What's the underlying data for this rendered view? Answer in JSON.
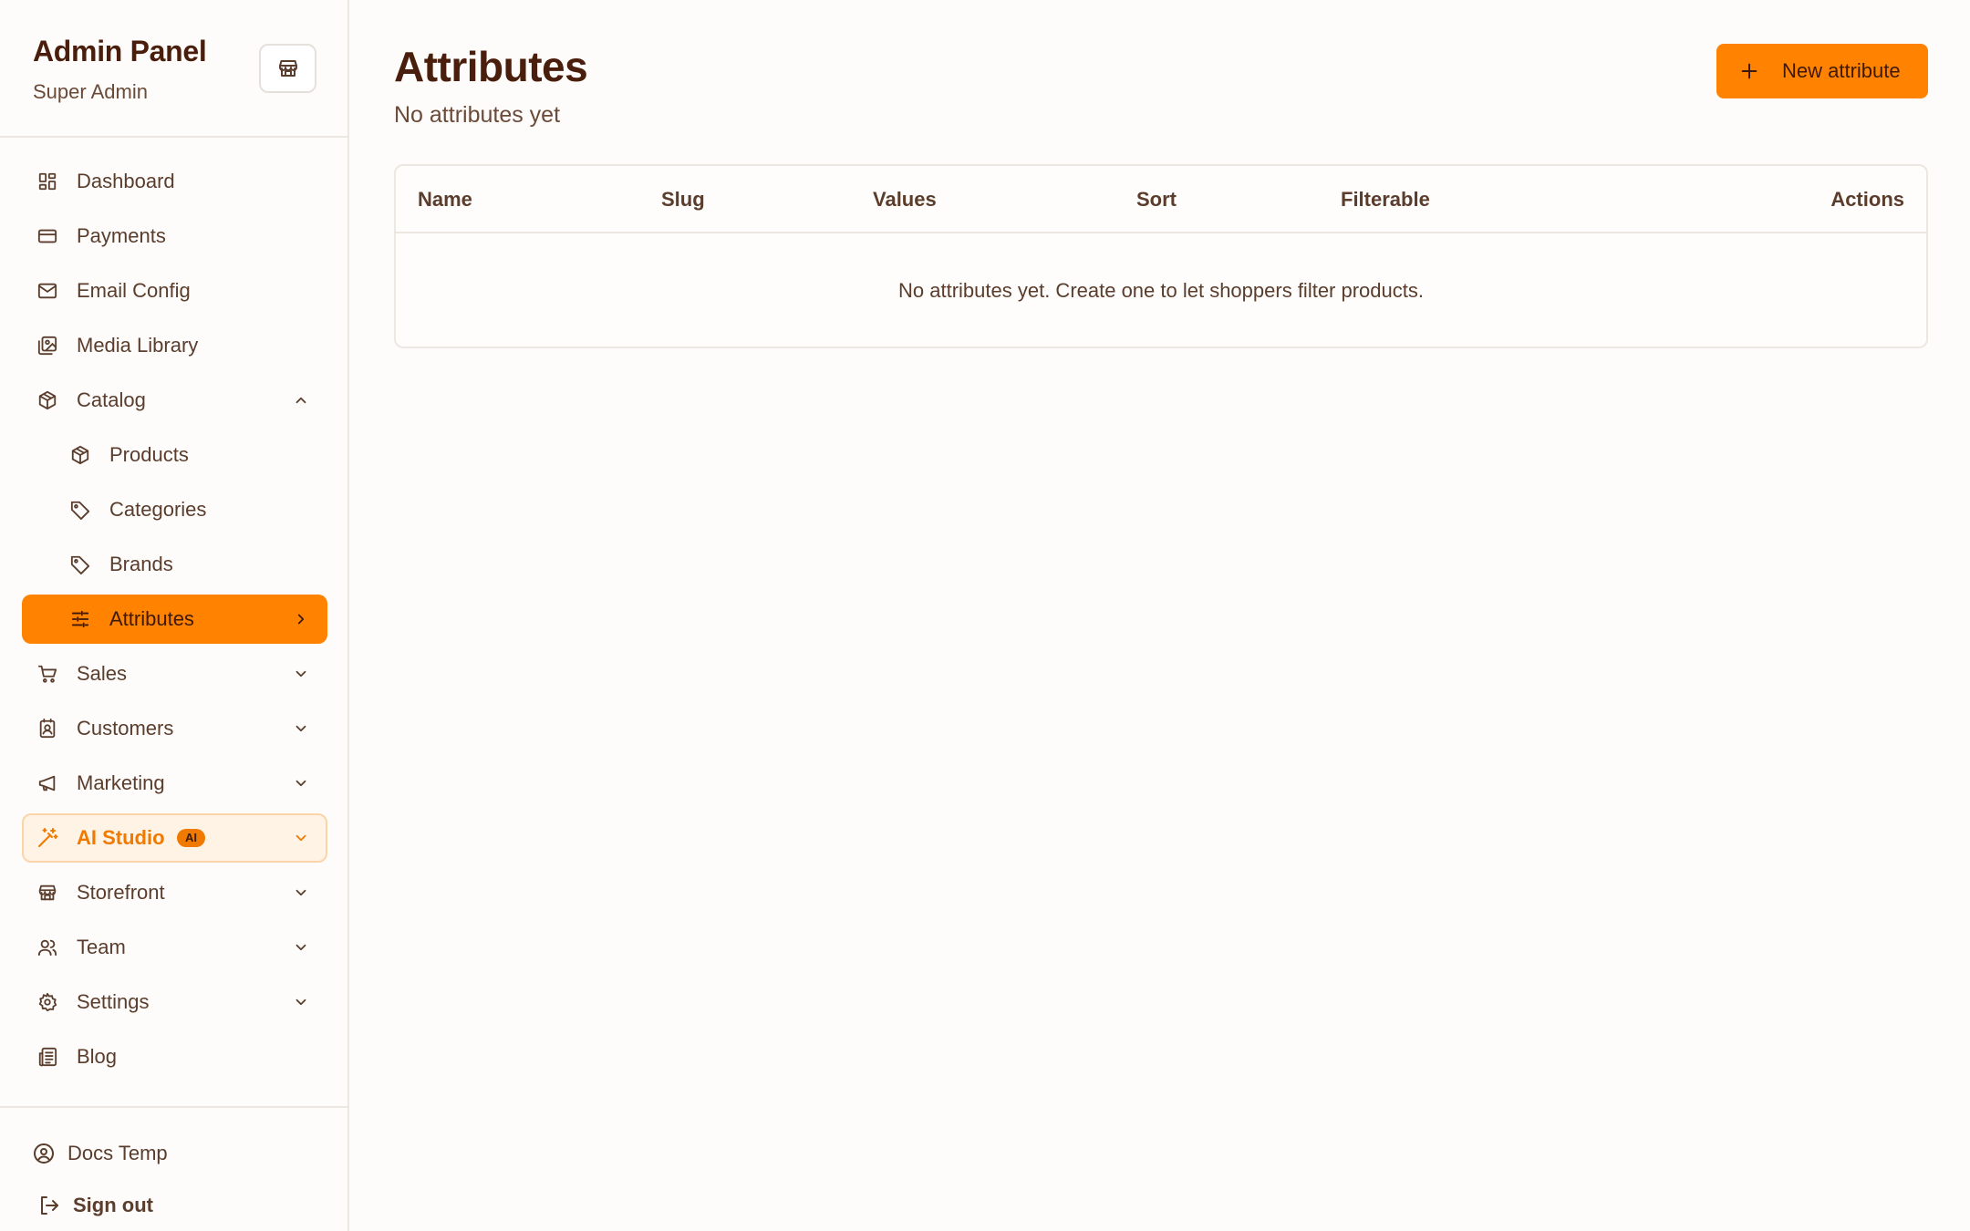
{
  "sidebar": {
    "title": "Admin Panel",
    "role": "Super Admin",
    "items": [
      {
        "label": "Dashboard",
        "icon": "dashboard-icon"
      },
      {
        "label": "Payments",
        "icon": "credit-card-icon"
      },
      {
        "label": "Email Config",
        "icon": "mail-icon"
      },
      {
        "label": "Media Library",
        "icon": "image-library-icon"
      },
      {
        "label": "Catalog",
        "icon": "package-icon",
        "expanded": true
      },
      {
        "label": "Products",
        "icon": "package-icon"
      },
      {
        "label": "Categories",
        "icon": "tag-icon"
      },
      {
        "label": "Brands",
        "icon": "tag-icon"
      },
      {
        "label": "Attributes",
        "icon": "sliders-icon",
        "active": true
      },
      {
        "label": "Sales",
        "icon": "cart-icon"
      },
      {
        "label": "Customers",
        "icon": "contact-icon"
      },
      {
        "label": "Marketing",
        "icon": "megaphone-icon"
      },
      {
        "label": "AI Studio",
        "icon": "magic-wand-icon",
        "badge": "AI"
      },
      {
        "label": "Storefront",
        "icon": "store-icon"
      },
      {
        "label": "Team",
        "icon": "users-icon"
      },
      {
        "label": "Settings",
        "icon": "gear-icon"
      },
      {
        "label": "Blog",
        "icon": "newspaper-icon"
      }
    ],
    "footer": {
      "docs": "Docs Temp",
      "signout": "Sign out"
    }
  },
  "main": {
    "title": "Attributes",
    "subtitle": "No attributes yet",
    "new_button": "New attribute",
    "table": {
      "columns": [
        "Name",
        "Slug",
        "Values",
        "Sort",
        "Filterable",
        "Actions"
      ],
      "empty_message": "No attributes yet. Create one to let shoppers filter products."
    }
  },
  "colors": {
    "accent": "#ff8200",
    "title": "#4a1e0c",
    "text": "#5a3d2c",
    "border": "#ece7e1",
    "background": "#fdfcfa"
  }
}
